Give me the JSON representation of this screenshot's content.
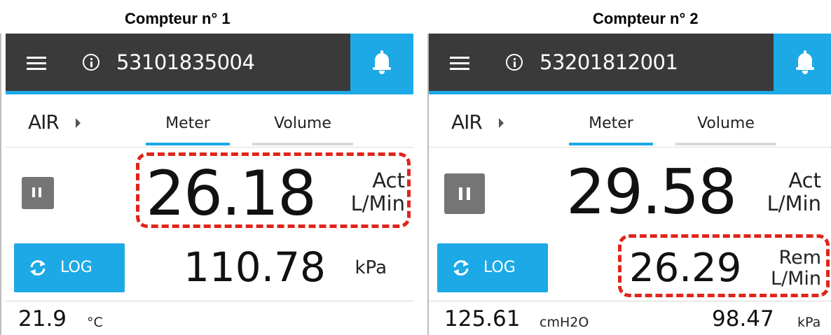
{
  "captions": [
    "Compteur n° 1",
    "Compteur n° 2"
  ],
  "colors": {
    "accent": "#1ca9e6",
    "topbar": "#3a3a3a",
    "highlight": "#e0241b",
    "pause": "#757575"
  },
  "meters": [
    {
      "icons": {
        "menu": "hamburger-icon",
        "info": "info-icon",
        "bell": "bell-icon",
        "pause": "pause-icon",
        "log": "sync-icon"
      },
      "serial": "53101835004",
      "fluid": "AIR",
      "tabs": {
        "meter": "Meter",
        "volume": "Volume"
      },
      "primary": {
        "value": "26.18",
        "unit_top": "Act",
        "unit_bottom": "L/Min",
        "highlighted": true
      },
      "log_label": "LOG",
      "secondary": {
        "value": "110.78",
        "unit": "kPa"
      },
      "bottom": {
        "left_value": "21.9",
        "left_unit": "°C"
      }
    },
    {
      "icons": {
        "menu": "hamburger-icon",
        "info": "info-icon",
        "bell": "bell-icon",
        "pause": "pause-icon",
        "log": "sync-icon"
      },
      "serial": "53201812001",
      "fluid": "AIR",
      "tabs": {
        "meter": "Meter",
        "volume": "Volume"
      },
      "primary": {
        "value": "29.58",
        "unit_top": "Act",
        "unit_bottom": "L/Min",
        "highlighted": false
      },
      "log_label": "LOG",
      "secondary": {
        "value": "26.29",
        "unit_top": "Rem",
        "unit_bottom": "L/Min",
        "highlighted": true
      },
      "bottom": {
        "left_value": "125.61",
        "left_unit": "cmH2O",
        "right_value": "98.47",
        "right_unit": "kPa"
      }
    }
  ]
}
